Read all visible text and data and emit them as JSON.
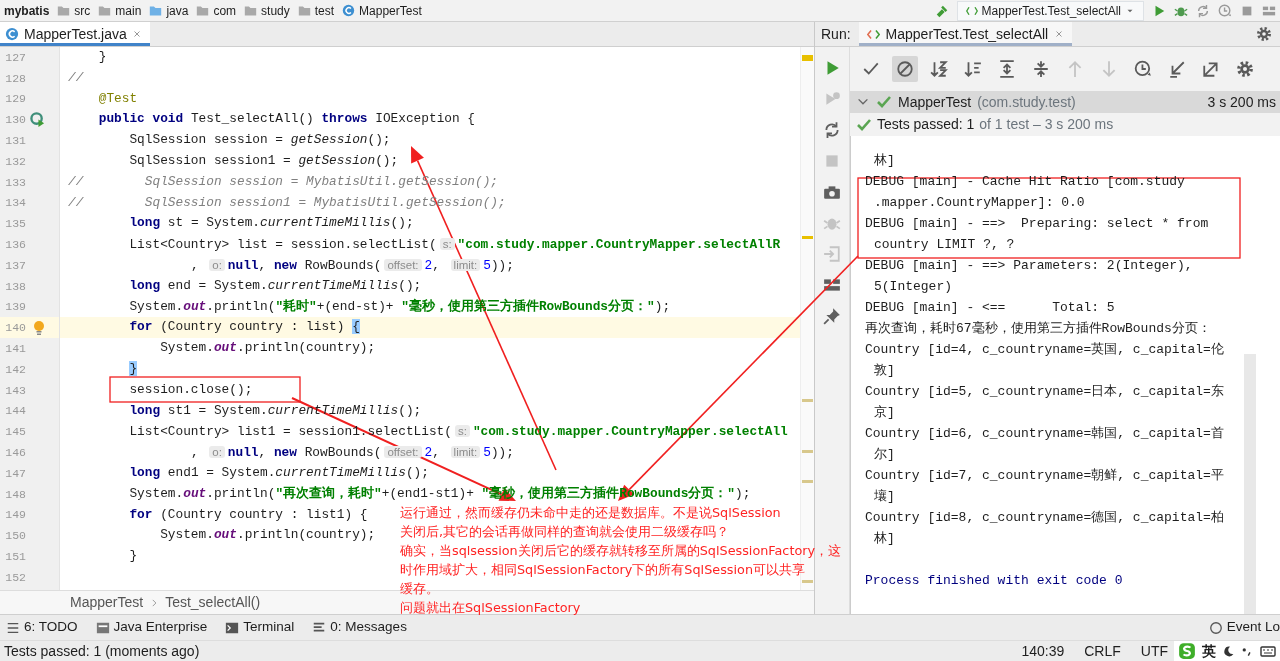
{
  "top_bar": {
    "breadcrumbs": [
      "mybatis",
      "src",
      "main",
      "java",
      "com",
      "study",
      "test",
      "MapperTest"
    ],
    "run_config": "MapperTest.Test_selectAll"
  },
  "editor": {
    "tab": {
      "label": "MapperTest.java",
      "selected": true
    },
    "lines": [
      {
        "number": "127",
        "current": false,
        "segments": [
          {
            "kind": "plain",
            "text": "    }"
          }
        ]
      },
      {
        "number": "128",
        "current": false,
        "segments": [
          {
            "kind": "comment",
            "text": "//"
          }
        ]
      },
      {
        "number": "129",
        "current": false,
        "segments": [
          {
            "kind": "annotation",
            "text": "    @Test"
          }
        ]
      },
      {
        "number": "130",
        "current": false,
        "marker": {
          "kind": "run"
        },
        "segments": [
          {
            "kind": "keyword",
            "text": "    public void "
          },
          {
            "kind": "plain",
            "text": "Test_selectAll() "
          },
          {
            "kind": "keyword",
            "text": "throws "
          },
          {
            "kind": "plain",
            "text": "IOException {"
          }
        ]
      },
      {
        "number": "131",
        "current": false,
        "segments": [
          {
            "kind": "plain",
            "text": "        SqlSession session = "
          },
          {
            "kind": "italic",
            "text": "getSession"
          },
          {
            "kind": "plain",
            "text": "();"
          }
        ]
      },
      {
        "number": "132",
        "current": false,
        "segments": [
          {
            "kind": "plain",
            "text": "        SqlSession session1 = "
          },
          {
            "kind": "italic",
            "text": "getSession"
          },
          {
            "kind": "plain",
            "text": "();"
          }
        ]
      },
      {
        "number": "133",
        "current": false,
        "segments": [
          {
            "kind": "comment",
            "text": "//        SqlSession session = MybatisUtil.getSession();"
          }
        ]
      },
      {
        "number": "134",
        "current": false,
        "segments": [
          {
            "kind": "comment",
            "text": "//        SqlSession session1 = MybatisUtil.getSession();"
          }
        ]
      },
      {
        "number": "135",
        "current": false,
        "segments": [
          {
            "kind": "keyword",
            "text": "        long "
          },
          {
            "kind": "plain",
            "text": "st = System."
          },
          {
            "kind": "italic",
            "text": "currentTimeMillis"
          },
          {
            "kind": "plain",
            "text": "();"
          }
        ]
      },
      {
        "number": "136",
        "current": false,
        "segments": [
          {
            "kind": "plain",
            "text": "        List<Country> list = session.selectList("
          },
          {
            "kind": "hint",
            "text": "s:"
          },
          {
            "kind": "string",
            "text": "\"com.study.mapper.CountryMapper.selectAllR"
          }
        ]
      },
      {
        "number": "137",
        "current": false,
        "segments": [
          {
            "kind": "plain",
            "text": "                , "
          },
          {
            "kind": "hint",
            "text": "o:"
          },
          {
            "kind": "keyword",
            "text": "null"
          },
          {
            "kind": "plain",
            "text": ", "
          },
          {
            "kind": "keyword",
            "text": "new "
          },
          {
            "kind": "plain",
            "text": "RowBounds("
          },
          {
            "kind": "hint",
            "text": "offset:"
          },
          {
            "kind": "number",
            "text": "2"
          },
          {
            "kind": "plain",
            "text": ", "
          },
          {
            "kind": "hint",
            "text": "limit:"
          },
          {
            "kind": "number",
            "text": "5"
          },
          {
            "kind": "plain",
            "text": "));"
          }
        ]
      },
      {
        "number": "138",
        "current": false,
        "segments": [
          {
            "kind": "keyword",
            "text": "        long "
          },
          {
            "kind": "plain",
            "text": "end = System."
          },
          {
            "kind": "italic",
            "text": "currentTimeMillis"
          },
          {
            "kind": "plain",
            "text": "();"
          }
        ]
      },
      {
        "number": "139",
        "current": false,
        "segments": [
          {
            "kind": "plain",
            "text": "        System."
          },
          {
            "kind": "field",
            "text": "out"
          },
          {
            "kind": "plain",
            "text": ".println("
          },
          {
            "kind": "string",
            "text": "\"耗时\""
          },
          {
            "kind": "plain",
            "text": "+(end-st)+ "
          },
          {
            "kind": "string",
            "text": "\"毫秒，使用第三方插件RowBounds分页：\""
          },
          {
            "kind": "plain",
            "text": ");"
          }
        ]
      },
      {
        "number": "140",
        "current": true,
        "marker": {
          "kind": "bulb"
        },
        "segments": [
          {
            "kind": "keyword",
            "text": "        for "
          },
          {
            "kind": "plain",
            "text": "(Country country : list) "
          },
          {
            "kind": "brace",
            "text": "{"
          }
        ]
      },
      {
        "number": "141",
        "current": false,
        "segments": [
          {
            "kind": "plain",
            "text": "            System."
          },
          {
            "kind": "field",
            "text": "out"
          },
          {
            "kind": "plain",
            "text": ".println(country);"
          }
        ]
      },
      {
        "number": "142",
        "current": false,
        "segments": [
          {
            "kind": "brace",
            "text": "        }"
          }
        ]
      },
      {
        "number": "143",
        "current": false,
        "segments": [
          {
            "kind": "plain",
            "text": "        session.close();"
          }
        ]
      },
      {
        "number": "144",
        "current": false,
        "segments": [
          {
            "kind": "keyword",
            "text": "        long "
          },
          {
            "kind": "plain",
            "text": "st1 = System."
          },
          {
            "kind": "italic",
            "text": "currentTimeMillis"
          },
          {
            "kind": "plain",
            "text": "();"
          }
        ]
      },
      {
        "number": "145",
        "current": false,
        "segments": [
          {
            "kind": "plain",
            "text": "        List<Country> list1 = session1.selectList("
          },
          {
            "kind": "hint",
            "text": "s:"
          },
          {
            "kind": "string",
            "text": "\"com.study.mapper.CountryMapper.selectAll"
          }
        ]
      },
      {
        "number": "146",
        "current": false,
        "segments": [
          {
            "kind": "plain",
            "text": "                , "
          },
          {
            "kind": "hint",
            "text": "o:"
          },
          {
            "kind": "keyword",
            "text": "null"
          },
          {
            "kind": "plain",
            "text": ", "
          },
          {
            "kind": "keyword",
            "text": "new "
          },
          {
            "kind": "plain",
            "text": "RowBounds("
          },
          {
            "kind": "hint",
            "text": "offset:"
          },
          {
            "kind": "number",
            "text": "2"
          },
          {
            "kind": "plain",
            "text": ", "
          },
          {
            "kind": "hint",
            "text": "limit:"
          },
          {
            "kind": "number",
            "text": "5"
          },
          {
            "kind": "plain",
            "text": "));"
          }
        ]
      },
      {
        "number": "147",
        "current": false,
        "segments": [
          {
            "kind": "keyword",
            "text": "        long "
          },
          {
            "kind": "plain",
            "text": "end1 = System."
          },
          {
            "kind": "italic",
            "text": "currentTimeMillis"
          },
          {
            "kind": "plain",
            "text": "();"
          }
        ]
      },
      {
        "number": "148",
        "current": false,
        "segments": [
          {
            "kind": "plain",
            "text": "        System."
          },
          {
            "kind": "field",
            "text": "out"
          },
          {
            "kind": "plain",
            "text": ".println("
          },
          {
            "kind": "string",
            "text": "\"再次查询，耗时\""
          },
          {
            "kind": "plain",
            "text": "+(end1-st1)+ "
          },
          {
            "kind": "string",
            "text": "\"毫秒，使用第三方插件RowBounds分页：\""
          },
          {
            "kind": "plain",
            "text": ");"
          }
        ]
      },
      {
        "number": "149",
        "current": false,
        "segments": [
          {
            "kind": "keyword",
            "text": "        for "
          },
          {
            "kind": "plain",
            "text": "(Country country : list1) {"
          }
        ]
      },
      {
        "number": "150",
        "current": false,
        "segments": [
          {
            "kind": "plain",
            "text": "            System."
          },
          {
            "kind": "field",
            "text": "out"
          },
          {
            "kind": "plain",
            "text": ".println(country);"
          }
        ]
      },
      {
        "number": "151",
        "current": false,
        "segments": [
          {
            "kind": "plain",
            "text": "        }"
          }
        ]
      },
      {
        "number": "152",
        "current": false
      }
    ],
    "breadcrumbs": [
      "MapperTest",
      "Test_selectAll()"
    ]
  },
  "run_panel": {
    "label": "Run:",
    "tab": {
      "label": "MapperTest.Test_selectAll",
      "selected": true
    },
    "side_tools": [
      {
        "disabled": false
      },
      {
        "disabled": true
      },
      {
        "disabled": false
      },
      {
        "disabled": true
      },
      {
        "disabled": false
      },
      {
        "disabled": true
      },
      {
        "disabled": true
      },
      {
        "disabled": false
      },
      {
        "disabled": false
      }
    ],
    "tools": [
      {
        "selected": false,
        "disabled": false
      },
      {
        "selected": true,
        "disabled": false
      },
      {
        "selected": false,
        "disabled": false
      },
      {
        "selected": false,
        "disabled": false
      },
      {
        "selected": false,
        "disabled": false
      },
      {
        "selected": false,
        "disabled": false
      },
      {
        "selected": false,
        "disabled": true
      },
      {
        "selected": false,
        "disabled": true
      },
      {
        "selected": false,
        "disabled": false
      },
      {
        "selected": false,
        "disabled": false
      },
      {
        "selected": false,
        "disabled": false
      },
      {
        "selected": false,
        "disabled": false
      }
    ],
    "tree": {
      "name": "MapperTest",
      "package": "(com.study.test)",
      "time": "3 s 200 ms",
      "expanded": true,
      "passed": true
    },
    "summary": {
      "status": "Tests passed: 1",
      "detail": "of 1 test – 3 s 200 ms"
    },
    "console": [
      {
        "kind": "log",
        "wrapped": true,
        "text": "林]"
      },
      {
        "kind": "log",
        "wrapped": false,
        "text": "DEBUG [main] - Cache Hit Ratio [com.study"
      },
      {
        "kind": "log",
        "wrapped": true,
        "text": ".mapper.CountryMapper]: 0.0"
      },
      {
        "kind": "log",
        "wrapped": false,
        "text": "DEBUG [main] - ==>  Preparing: select * from"
      },
      {
        "kind": "log",
        "wrapped": true,
        "text": "country LIMIT ?, ?"
      },
      {
        "kind": "log",
        "wrapped": false,
        "text": "DEBUG [main] - ==> Parameters: 2(Integer),"
      },
      {
        "kind": "log",
        "wrapped": true,
        "text": "5(Integer)"
      },
      {
        "kind": "log",
        "wrapped": false,
        "text": "DEBUG [main] - <==      Total: 5"
      },
      {
        "kind": "log",
        "wrapped": false,
        "text": "再次查询，耗时67毫秒，使用第三方插件RowBounds分页："
      },
      {
        "kind": "log",
        "wrapped": false,
        "text": "Country [id=4, c_countryname=英国, c_capital=伦"
      },
      {
        "kind": "log",
        "wrapped": true,
        "text": "敦]"
      },
      {
        "kind": "log",
        "wrapped": false,
        "text": "Country [id=5, c_countryname=日本, c_capital=东"
      },
      {
        "kind": "log",
        "wrapped": true,
        "text": "京]"
      },
      {
        "kind": "log",
        "wrapped": false,
        "text": "Country [id=6, c_countryname=韩国, c_capital=首"
      },
      {
        "kind": "log",
        "wrapped": true,
        "text": "尔]"
      },
      {
        "kind": "log",
        "wrapped": false,
        "text": "Country [id=7, c_countryname=朝鲜, c_capital=平"
      },
      {
        "kind": "log",
        "wrapped": true,
        "text": "壤]"
      },
      {
        "kind": "log",
        "wrapped": false,
        "text": "Country [id=8, c_countryname=德国, c_capital=柏"
      },
      {
        "kind": "log",
        "wrapped": true,
        "text": "林]"
      },
      {
        "kind": "exit",
        "wrapped": false,
        "text": "Process finished with exit code 0"
      }
    ]
  },
  "tool_windows": [
    "6: TODO",
    "Java Enterprise",
    "Terminal",
    "0: Messages",
    "Event Lo"
  ],
  "status_bar": {
    "message": "Tests passed: 1 (moments ago)",
    "position": "140:39",
    "line_separator": "CRLF",
    "encoding": "UTF",
    "ime": "英"
  },
  "annotation": {
    "lines": [
      "运行通过，然而缓存仍未命中走的还是数据库。不是说SqlSession",
      "关闭后,其它的会话再做同样的查询就会使用二级缓存吗？",
      "确实，当sqlsession关闭后它的缓存就转移至所属的SqlSessionFactory，这",
      "时作用域扩大，相同SqlSessionFactory下的所有SqlSession可以共享",
      "缓存。",
      "问题就出在SqlSessionFactory"
    ]
  }
}
